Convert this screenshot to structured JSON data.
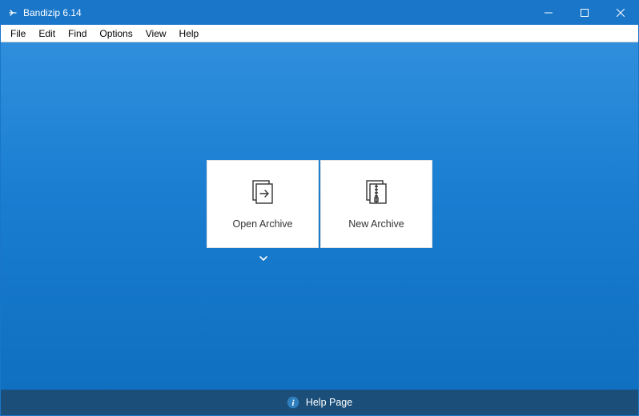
{
  "window": {
    "title": "Bandizip 6.14"
  },
  "menu": {
    "items": [
      "File",
      "Edit",
      "Find",
      "Options",
      "View",
      "Help"
    ]
  },
  "main": {
    "open_archive_label": "Open Archive",
    "new_archive_label": "New Archive"
  },
  "footer": {
    "help_label": "Help Page"
  },
  "colors": {
    "titlebar": "#1976c9",
    "gradient_top": "#2f8fdd",
    "gradient_bottom": "#0f6fc0",
    "footer": "#1b4f7a"
  }
}
